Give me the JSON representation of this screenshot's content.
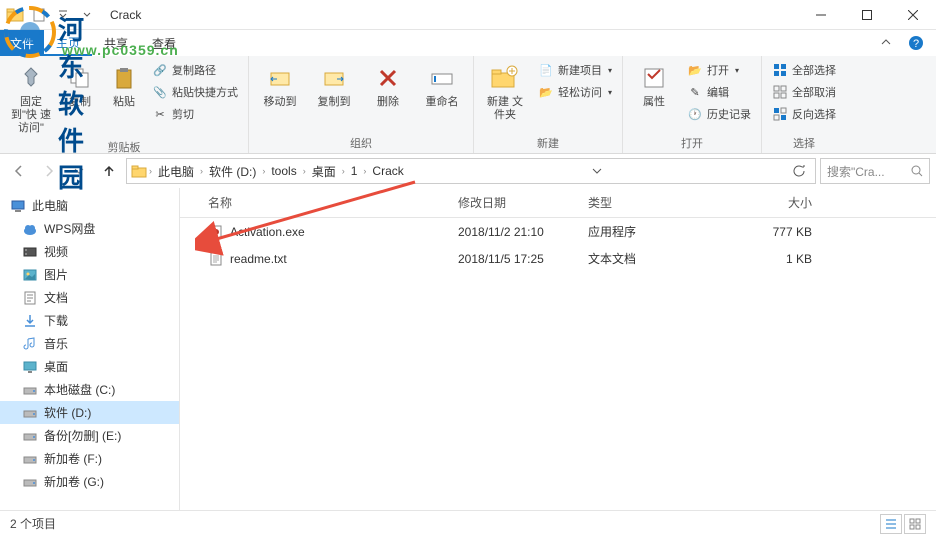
{
  "window": {
    "title": "Crack"
  },
  "menubar": {
    "file": "文件",
    "tabs": [
      "主页",
      "共享",
      "查看"
    ],
    "active": 0
  },
  "ribbon": {
    "group1": {
      "label": "剪贴板",
      "pin": "固定到\"快\n速访问\"",
      "copy": "复制",
      "paste": "粘贴",
      "copyPath": "复制路径",
      "pasteShortcut": "粘贴快捷方式",
      "cut": "剪切"
    },
    "group2": {
      "label": "组织",
      "moveTo": "移动到",
      "copyTo": "复制到",
      "delete": "删除",
      "rename": "重命名"
    },
    "group3": {
      "label": "新建",
      "newFolder": "新建\n文件夹",
      "newItem": "新建项目",
      "easyAccess": "轻松访问"
    },
    "group4": {
      "label": "打开",
      "properties": "属性",
      "open": "打开",
      "edit": "编辑",
      "history": "历史记录"
    },
    "group5": {
      "label": "选择",
      "selectAll": "全部选择",
      "selectNone": "全部取消",
      "invert": "反向选择"
    }
  },
  "breadcrumbs": [
    "此电脑",
    "软件 (D:)",
    "tools",
    "桌面",
    "1",
    "Crack"
  ],
  "search": {
    "placeholder": "搜索\"Cra..."
  },
  "navPane": [
    {
      "label": "此电脑",
      "icon": "pc",
      "root": true
    },
    {
      "label": "WPS网盘",
      "icon": "cloud"
    },
    {
      "label": "视频",
      "icon": "video"
    },
    {
      "label": "图片",
      "icon": "pictures"
    },
    {
      "label": "文档",
      "icon": "documents"
    },
    {
      "label": "下载",
      "icon": "downloads"
    },
    {
      "label": "音乐",
      "icon": "music"
    },
    {
      "label": "桌面",
      "icon": "desktop"
    },
    {
      "label": "本地磁盘 (C:)",
      "icon": "drive"
    },
    {
      "label": "软件 (D:)",
      "icon": "drive",
      "selected": true
    },
    {
      "label": "备份[勿删] (E:)",
      "icon": "drive"
    },
    {
      "label": "新加卷 (F:)",
      "icon": "drive"
    },
    {
      "label": "新加卷 (G:)",
      "icon": "drive"
    }
  ],
  "columns": {
    "name": "名称",
    "date": "修改日期",
    "type": "类型",
    "size": "大小"
  },
  "files": [
    {
      "name": "Activation.exe",
      "date": "2018/11/2 21:10",
      "type": "应用程序",
      "size": "777 KB",
      "icon": "exe"
    },
    {
      "name": "readme.txt",
      "date": "2018/11/5 17:25",
      "type": "文本文档",
      "size": "1 KB",
      "icon": "txt"
    }
  ],
  "status": {
    "count": "2 个项目"
  },
  "watermark": {
    "text1": "河东软件园",
    "text2": "www.pc0359.cn"
  }
}
